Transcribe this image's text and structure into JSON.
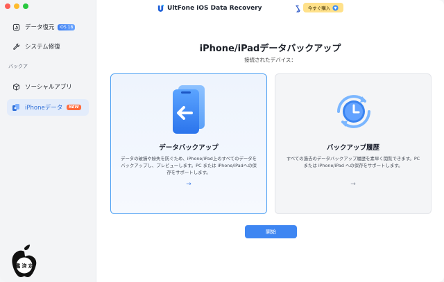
{
  "app": {
    "title": "UltFone iOS Data Recovery"
  },
  "header": {
    "buy_label": "今すぐ購入"
  },
  "sidebar": {
    "items": [
      {
        "label": "データ復元",
        "badge": "iOS 18"
      },
      {
        "label": "システム修復"
      }
    ],
    "section_label": "バックア",
    "backup_items": [
      {
        "label": "ソーシャルアプリ"
      },
      {
        "label": "iPhoneデータ",
        "badge": "NEW"
      }
    ]
  },
  "main": {
    "title": "iPhone/iPadデータバックアップ",
    "subtitle": "接続されたデバイス：",
    "cards": [
      {
        "title": "データバックアップ",
        "desc": "データの破損や紛失を防ぐため、iPhone/iPad上のすべてのデータをバックアップし、プレビューします。PC または iPhone/iPadへの保存をサポートします。",
        "arrow": "→"
      },
      {
        "title": "バックアップ履歴",
        "desc": "すべての過去のデータバックアップ履歴を素早く閲覧できます。PC または iPhone/iPad への保存をサポートします。",
        "arrow": "→"
      }
    ],
    "start_label": "開始"
  },
  "seal": {
    "text": "鑑 済 定"
  },
  "colors": {
    "accent": "#3e86f2",
    "active_bg": "#e3ecfb",
    "buy_bg": "#ffe18a"
  }
}
